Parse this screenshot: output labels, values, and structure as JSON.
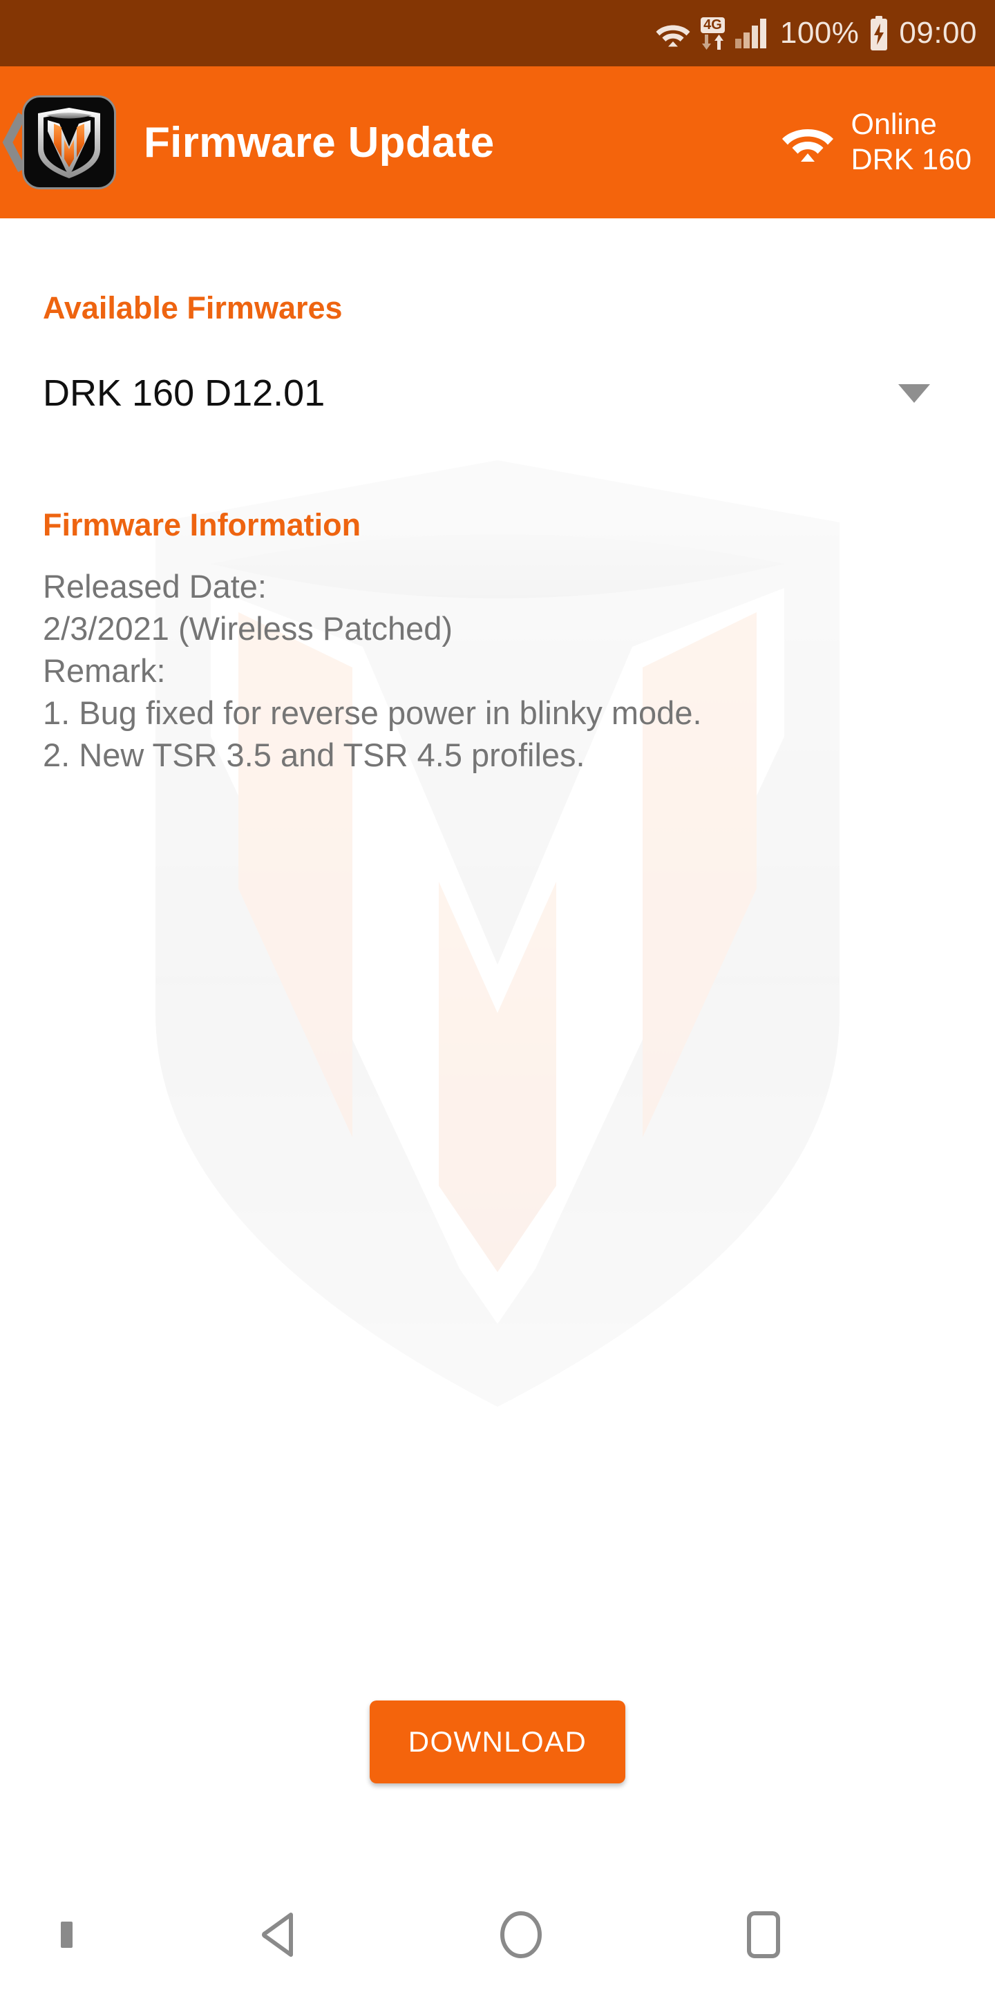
{
  "status_bar": {
    "wifi_icon": "wifi-icon",
    "network_badge": "4G",
    "data_arrows_icon": "data-transfer-arrows-icon",
    "signal_icon": "cellular-signal-icon",
    "battery_percent": "100%",
    "battery_icon": "battery-charging-icon",
    "time": "09:00",
    "background_color": "#843604",
    "text_color": "#f2e5dc"
  },
  "app_bar": {
    "back_icon": "back-chevron-icon",
    "logo_icon": "app-logo-m-shield-icon",
    "title": "Firmware Update",
    "connection": {
      "wifi_icon": "wifi-icon",
      "status": "Online",
      "device": "DRK 160"
    },
    "background_color": "#F4640C",
    "title_color": "#FFFFFF"
  },
  "main": {
    "available_firmwares": {
      "heading": "Available Firmwares",
      "selected": "DRK 160 D12.01",
      "caret_icon": "chevron-down-icon"
    },
    "firmware_information": {
      "heading": "Firmware Information",
      "body": "Released Date:\n2/3/2021 (Wireless Patched)\nRemark:\n1. Bug fixed for reverse power in blinky mode.\n2. New TSR 3.5 and TSR 4.5 profiles.",
      "released_date_label": "Released Date:",
      "released_date_value": "2/3/2021 (Wireless Patched)",
      "remark_label": "Remark:",
      "remarks": [
        "1. Bug fixed for reverse power in blinky mode.",
        "2. New TSR 3.5 and TSR 4.5 profiles."
      ]
    },
    "download_button": "DOWNLOAD",
    "watermark_icon": "m-shield-watermark-icon",
    "heading_color": "#EE6410",
    "body_text_color": "#757575",
    "accent_color": "#F4640C"
  },
  "nav_bar": {
    "dot_icon": "nav-indicator-dot-icon",
    "back_icon": "nav-back-triangle-icon",
    "home_icon": "nav-home-circle-icon",
    "recents_icon": "nav-recents-square-icon",
    "icon_color": "#8a8a8a"
  }
}
